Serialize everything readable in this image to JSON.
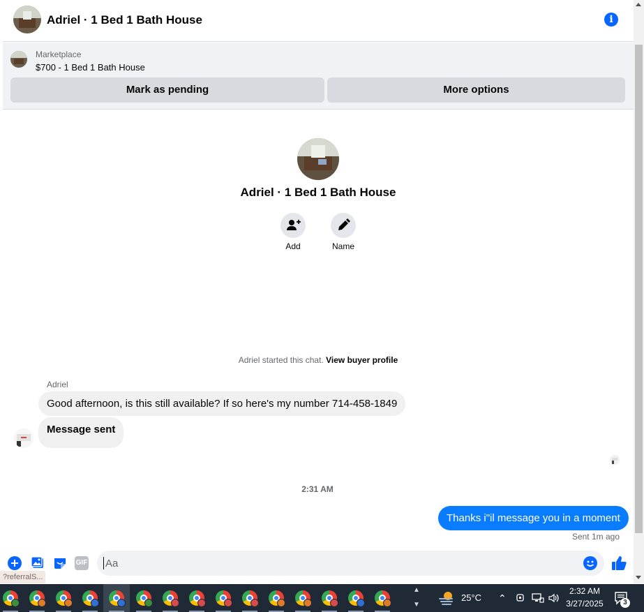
{
  "header": {
    "title": "Adriel · 1 Bed 1 Bath House",
    "info_glyph": "i"
  },
  "marketplace": {
    "label": "Marketplace",
    "listing": "$700 - 1 Bed 1 Bath House",
    "pending_button": "Mark as pending",
    "more_button": "More options"
  },
  "profile": {
    "name": "Adriel · 1 Bed 1 Bath House",
    "add_label": "Add",
    "name_label": "Name"
  },
  "conversation": {
    "system_note": "Adriel started this chat.",
    "buyer_profile_link": "View buyer profile",
    "sender_name": "Adriel",
    "messages_in": [
      "Good afternoon, is this still available? If so here's my number 714-458-1849",
      "Message sent"
    ],
    "timestamp": "2:31 AM",
    "message_out": "Thanks i\"il message you in a moment",
    "sent_status": "Sent 1m ago"
  },
  "composer": {
    "placeholder": "Aa",
    "gif_label": "GIF"
  },
  "browser_status": {
    "url_fragment": "?referralS..."
  },
  "taskbar": {
    "temperature": "25°C",
    "time": "2:32 AM",
    "date": "3/27/2025",
    "notification_count": "3",
    "profile_colors": [
      "#3c8f3c",
      "#e07b2a",
      "#e07b2a",
      "#2f6fd6",
      "#2f6fd6",
      "#3c8f3c",
      "#d94b4b",
      "#d94b4b",
      "#d94b4b",
      "#d94b4b",
      "#e07b2a",
      "#e07b2a",
      "#d94b4b",
      "#2f6fd6",
      "#e07b2a"
    ]
  },
  "colors": {
    "messenger_blue": "#0a7cff",
    "accent_blue": "#0866ff",
    "taskbar_bg": "#1f2a36"
  }
}
